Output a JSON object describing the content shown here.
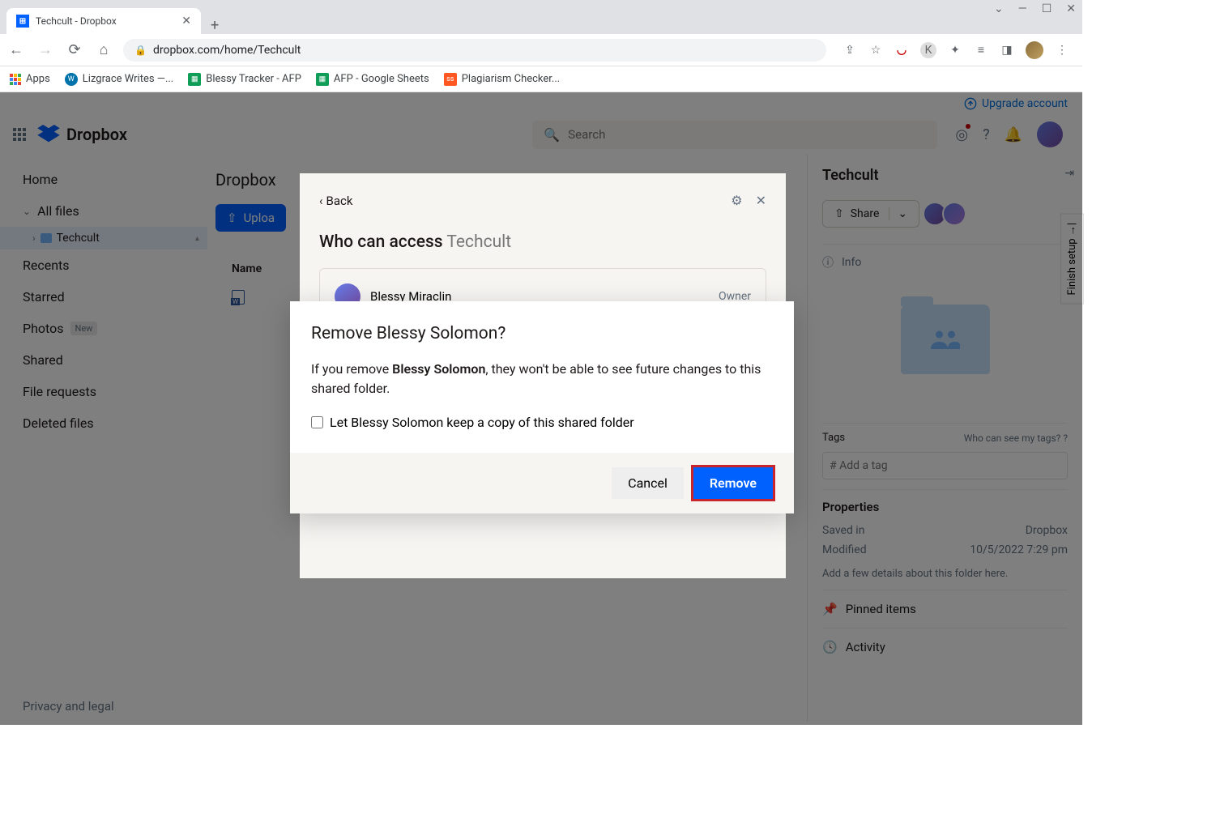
{
  "browser": {
    "tab_title": "Techcult - Dropbox",
    "url": "dropbox.com/home/Techcult",
    "bookmarks": [
      "Apps",
      "Lizgrace Writes —...",
      "Blessy Tracker - AFP",
      "AFP - Google Sheets",
      "Plagiarism Checker..."
    ]
  },
  "upgrade_link": "Upgrade account",
  "logo_text": "Dropbox",
  "search_placeholder": "Search",
  "sidebar": {
    "home": "Home",
    "all_files": "All files",
    "current_folder": "Techcult",
    "recents": "Recents",
    "starred": "Starred",
    "photos": "Photos",
    "photos_badge": "New",
    "shared": "Shared",
    "file_requests": "File requests",
    "deleted": "Deleted files"
  },
  "content": {
    "breadcrumb": "Dropbox",
    "upload": "Uploa",
    "col_name": "Name"
  },
  "details": {
    "title": "Techcult",
    "share": "Share",
    "info": "Info",
    "tags_label": "Tags",
    "tags_link": "Who can see my tags?",
    "tag_placeholder": "# Add a tag",
    "properties_label": "Properties",
    "props": {
      "saved_in_label": "Saved in",
      "saved_in_value": "Dropbox",
      "modified_label": "Modified",
      "modified_value": "10/5/2022 7:29 pm"
    },
    "add_details": "Add a few details about this folder here.",
    "pinned": "Pinned items",
    "activity": "Activity"
  },
  "finish_setup": "Finish setup",
  "privacy": "Privacy and legal",
  "share_modal": {
    "back": "Back",
    "who_prefix": "Who can access",
    "who_name": "Techcult",
    "person": "Blessy Miraclin",
    "role": "Owner"
  },
  "remove_dialog": {
    "title": "Remove Blessy Solomon?",
    "text_prefix": "If you remove ",
    "text_name": "Blessy Solomon",
    "text_suffix": ", they won't be able to see future changes to this shared folder.",
    "keep_copy": "Let Blessy Solomon keep a copy of this shared folder",
    "cancel": "Cancel",
    "remove": "Remove"
  }
}
